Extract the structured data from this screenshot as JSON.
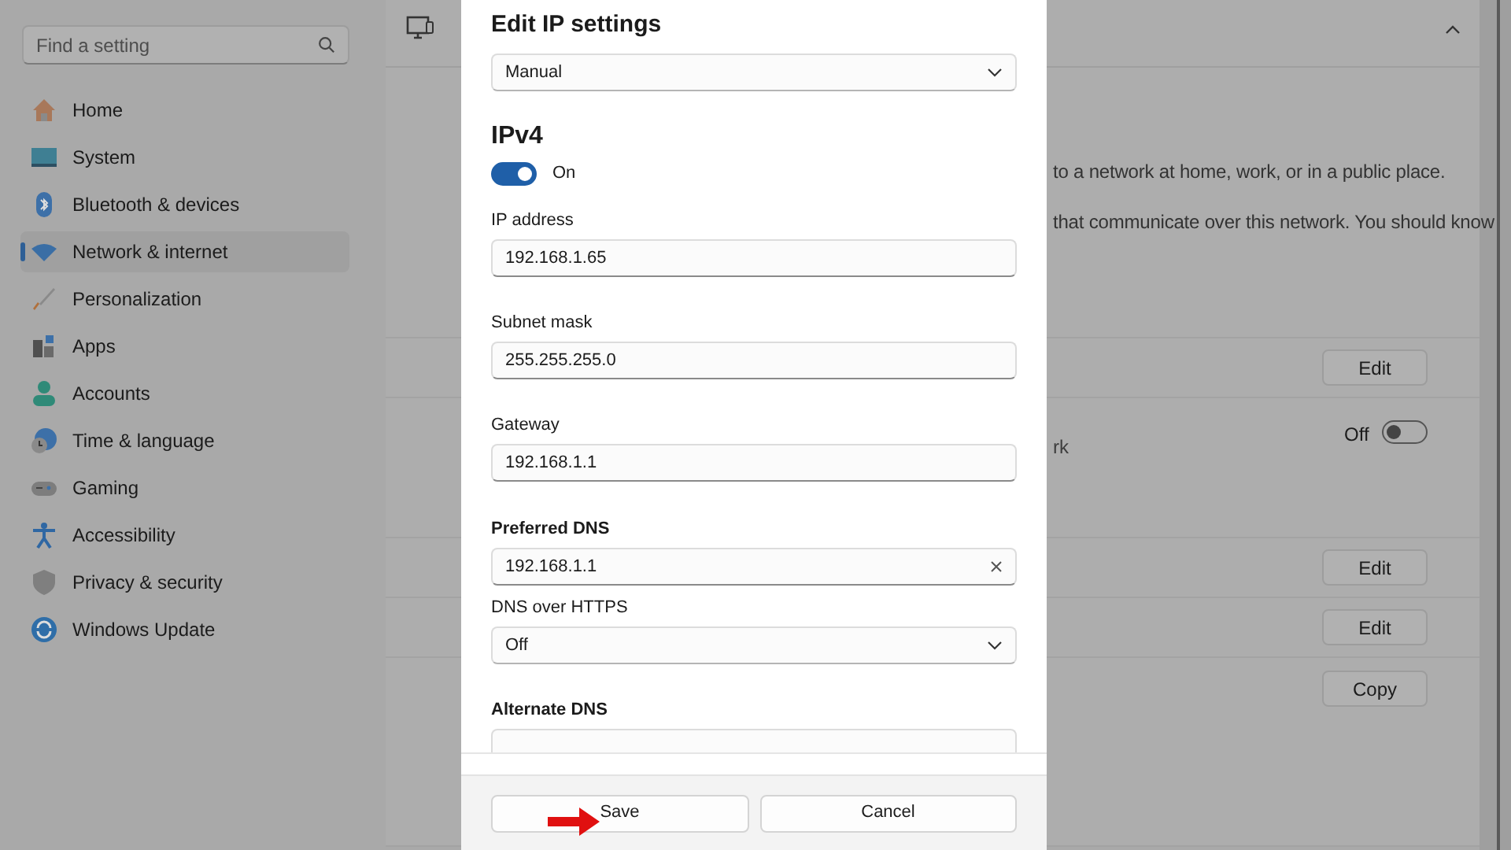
{
  "sidebar": {
    "search": {
      "placeholder": "Find a setting"
    },
    "items": [
      {
        "label": "Home",
        "selected": false
      },
      {
        "label": "System",
        "selected": false
      },
      {
        "label": "Bluetooth & devices",
        "selected": false
      },
      {
        "label": "Network & internet",
        "selected": true
      },
      {
        "label": "Personalization",
        "selected": false
      },
      {
        "label": "Apps",
        "selected": false
      },
      {
        "label": "Accounts",
        "selected": false
      },
      {
        "label": "Time & language",
        "selected": false
      },
      {
        "label": "Gaming",
        "selected": false
      },
      {
        "label": "Accessibility",
        "selected": false
      },
      {
        "label": "Privacy & security",
        "selected": false
      },
      {
        "label": "Windows Update",
        "selected": false
      }
    ]
  },
  "background": {
    "profile": {
      "options": [
        "to a network at home, work, or in a public place.",
        "that communicate over this network. You should know"
      ]
    },
    "rows": [
      {
        "kind": "button",
        "button": "Edit"
      },
      {
        "kind": "toggle",
        "fragment": "rk",
        "state": "Off",
        "on": false
      },
      {
        "kind": "button",
        "button": "Edit"
      },
      {
        "kind": "button",
        "button": "Edit"
      },
      {
        "kind": "list",
        "button": "Copy"
      }
    ]
  },
  "dialog": {
    "title": "Edit IP settings",
    "mode": "Manual",
    "section": "IPv4",
    "toggle": {
      "on": true,
      "label": "On"
    },
    "items": [
      {
        "kind": "text_field",
        "label": "IP address",
        "value": "192.168.1.65"
      },
      {
        "kind": "text_field",
        "label": "Subnet mask",
        "value": "255.255.255.0"
      },
      {
        "kind": "text_field",
        "label": "Gateway",
        "value": "192.168.1.1"
      },
      {
        "kind": "dns_field",
        "label": "Preferred DNS",
        "value": "192.168.1.1"
      },
      {
        "kind": "dropdown",
        "label": "DNS over HTTPS",
        "value": "Off"
      },
      {
        "kind": "cut_field",
        "label": "Alternate DNS"
      }
    ],
    "buttons": [
      "Save",
      "Cancel"
    ]
  }
}
